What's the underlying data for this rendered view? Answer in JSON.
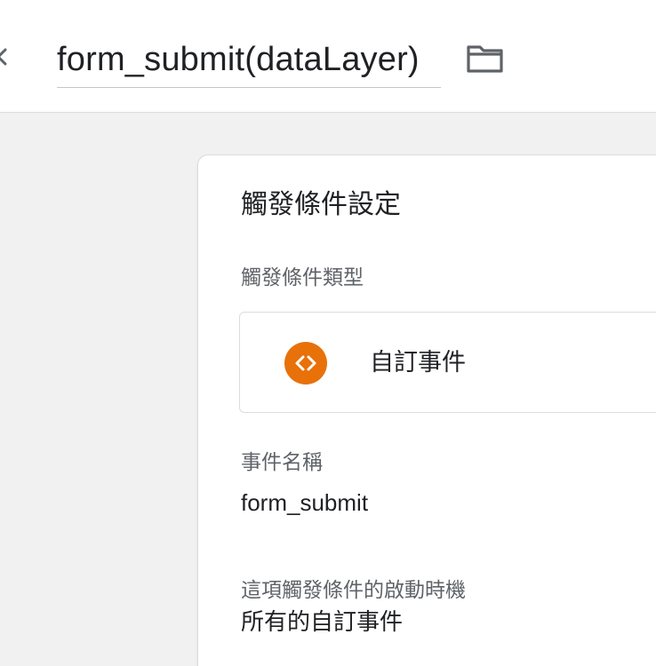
{
  "header": {
    "title": "form_submit(dataLayer)",
    "close_icon": "close-icon",
    "folder_icon": "folder-icon"
  },
  "card": {
    "title": "觸發條件設定",
    "trigger_type": {
      "label": "觸發條件類型",
      "value": "自訂事件",
      "icon": "code-icon",
      "icon_color": "#e8710a"
    },
    "event_name": {
      "label": "事件名稱",
      "value": "form_submit"
    },
    "fires_on": {
      "label": "這項觸發條件的啟動時機",
      "value": "所有的自訂事件"
    }
  }
}
